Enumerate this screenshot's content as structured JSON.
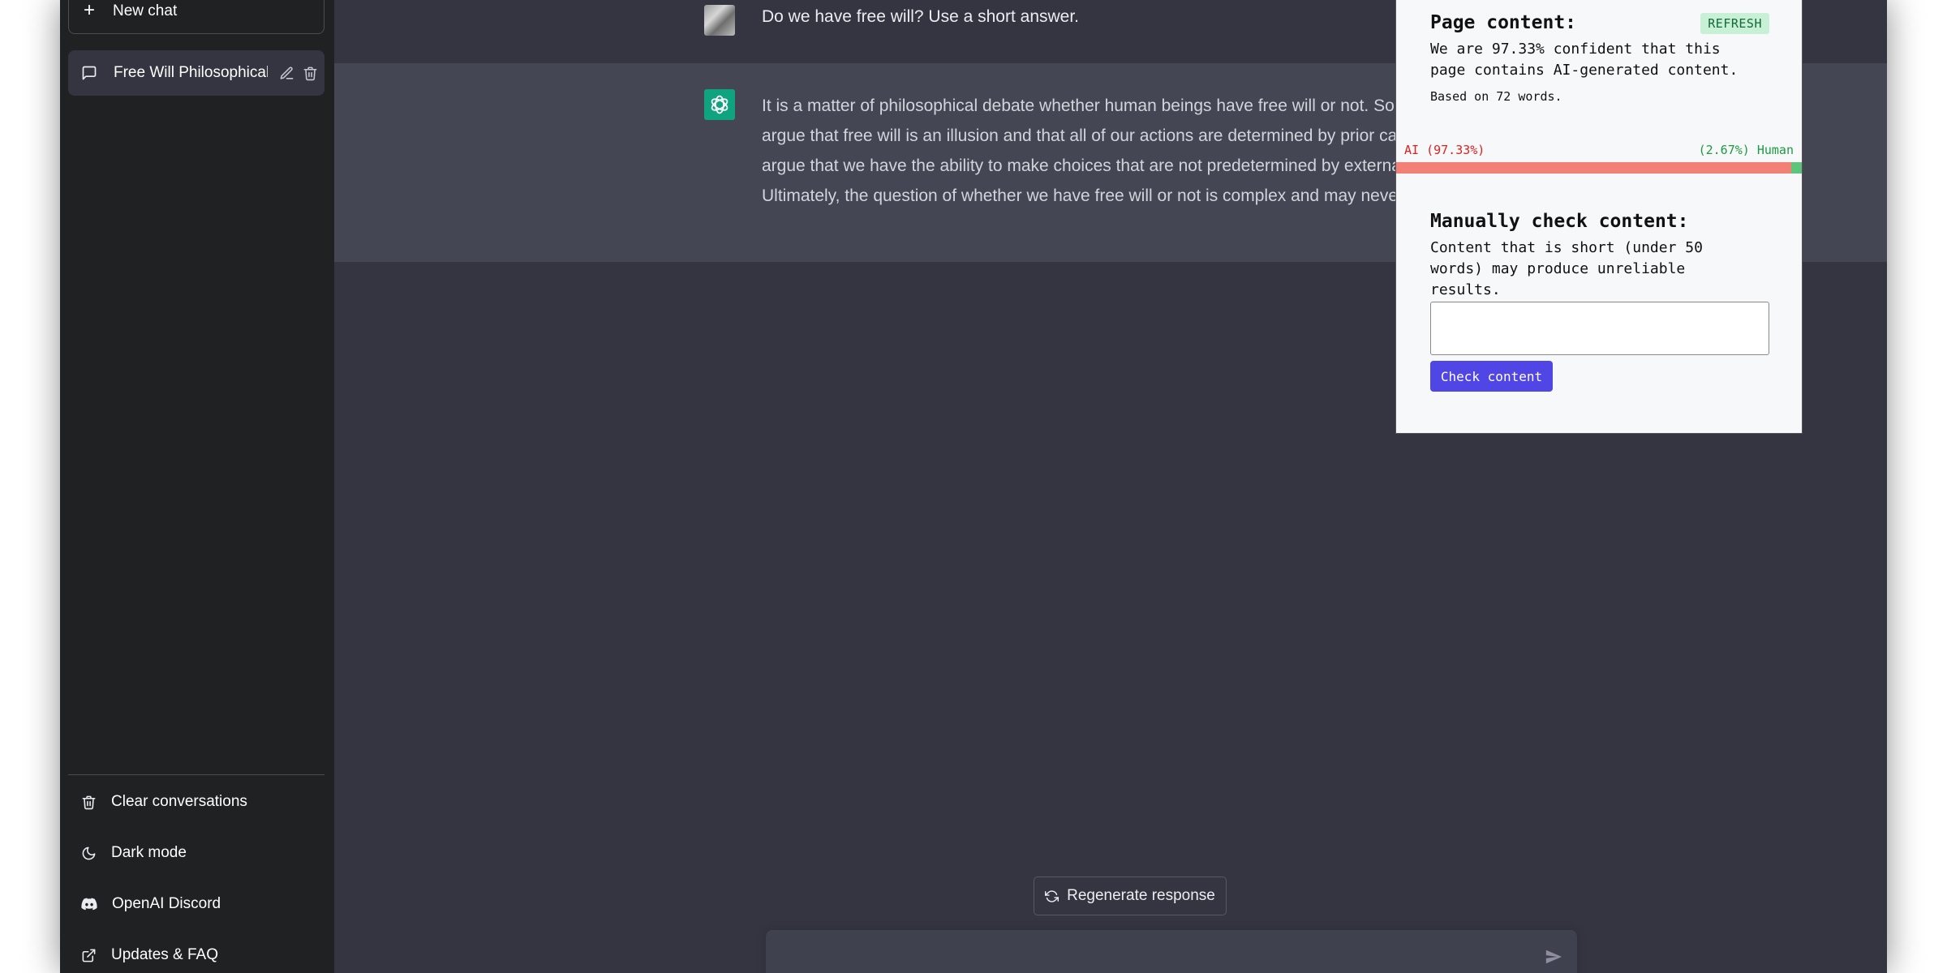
{
  "sidebar": {
    "new_chat_label": "New chat",
    "conversations": [
      {
        "title": "Free Will Philosophical"
      }
    ],
    "bottom_links": [
      {
        "label": "Clear conversations",
        "icon": "trash-icon"
      },
      {
        "label": "Dark mode",
        "icon": "moon-icon"
      },
      {
        "label": "OpenAI Discord",
        "icon": "discord-icon"
      },
      {
        "label": "Updates & FAQ",
        "icon": "external-link-icon"
      }
    ]
  },
  "chat": {
    "user_message": "Do we have free will? Use a short answer.",
    "assistant_message": "It is a matter of philosophical debate whether human beings have free will or not. Some philosophers argue that free will is an illusion and that all of our actions are determined by prior causes, while others argue that we have the ability to make choices that are not predetermined by external factors. Ultimately, the question of whether we have free will or not is complex and may never be fully resolved.",
    "regenerate_label": "Regenerate response",
    "composer_placeholder": ""
  },
  "detector": {
    "page_content_title": "Page content:",
    "refresh_label": "REFRESH",
    "confidence_text": "We are 97.33% confident that this page contains AI-generated content.",
    "based_on_text": "Based on 72 words.",
    "ai_label": "AI (97.33%)",
    "human_label": "(2.67%) Human",
    "ai_fraction": 0.9733,
    "manual_title": "Manually check content:",
    "manual_note": "Content that is short (under 50 words) may produce unreliable results.",
    "input_value": "",
    "check_button_label": "Check content"
  },
  "colors": {
    "sidebar_bg": "#202123",
    "chat_bg": "#343541",
    "assistant_row_bg": "#444654",
    "accent_green": "#10a37f",
    "ai_bar": "#f28076",
    "human_bar": "#5cc57a",
    "check_button": "#4f46e5"
  }
}
